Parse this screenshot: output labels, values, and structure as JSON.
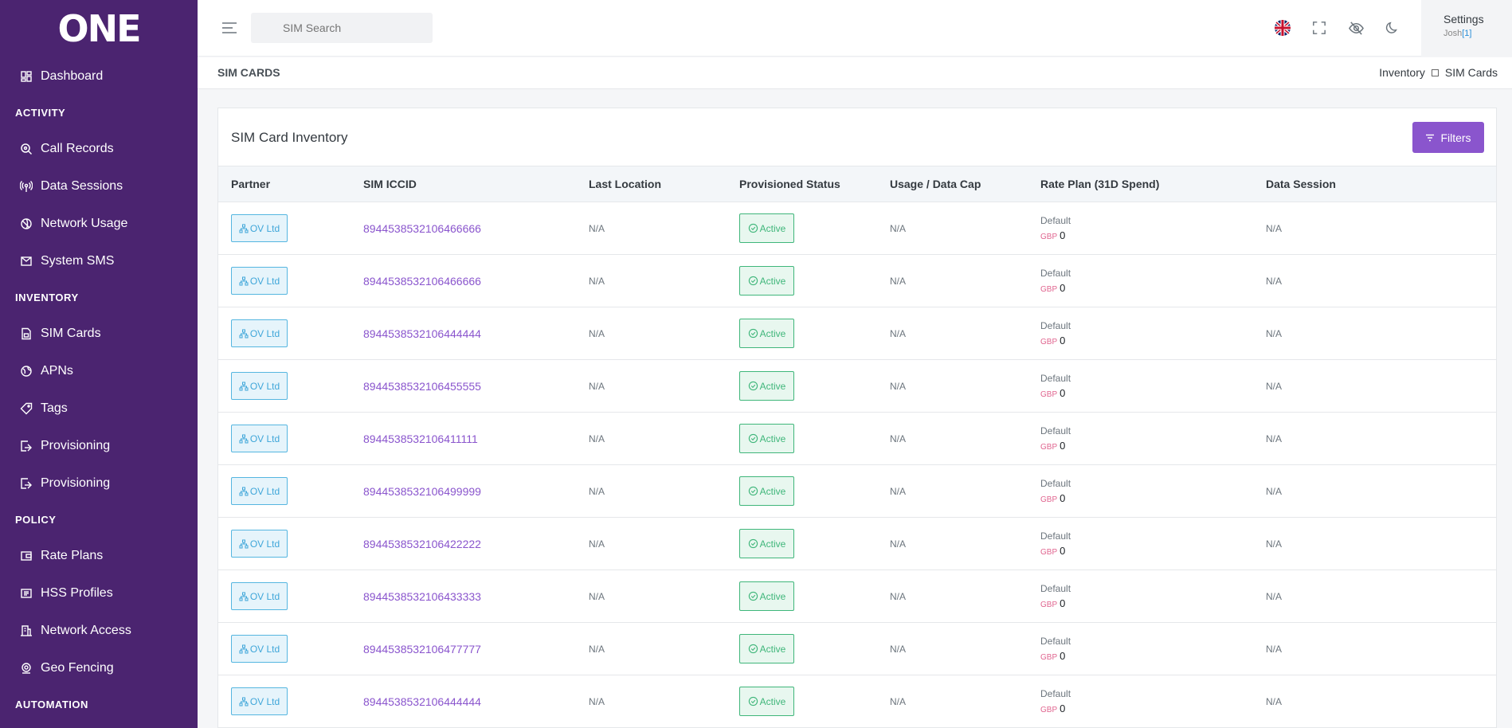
{
  "app": {
    "logo_text": "ONE"
  },
  "sidebar": {
    "dashboard": "Dashboard",
    "sections": {
      "activity": "ACTIVITY",
      "inventory": "INVENTORY",
      "policy": "POLICY",
      "automation": "AUTOMATION"
    },
    "activity_items": [
      {
        "label": "Call Records",
        "icon": "search-icon"
      },
      {
        "label": "Data Sessions",
        "icon": "broadcast-icon"
      },
      {
        "label": "Network Usage",
        "icon": "network-icon"
      },
      {
        "label": "System SMS",
        "icon": "mail-icon"
      }
    ],
    "inventory_items": [
      {
        "label": "SIM Cards",
        "icon": "sim-icon"
      },
      {
        "label": "APNs",
        "icon": "globe-icon"
      },
      {
        "label": "Tags",
        "icon": "tag-icon"
      },
      {
        "label": "Provisioning",
        "icon": "provision-icon"
      },
      {
        "label": "Provisioning",
        "icon": "provision-icon"
      }
    ],
    "policy_items": [
      {
        "label": "Rate Plans",
        "icon": "wallet-icon"
      },
      {
        "label": "HSS Profiles",
        "icon": "list-icon"
      },
      {
        "label": "Network Access",
        "icon": "building-icon"
      },
      {
        "label": "Geo Fencing",
        "icon": "location-icon"
      }
    ]
  },
  "topbar": {
    "search_placeholder": "SIM Search",
    "settings_label": "Settings",
    "user_name": "Josh",
    "user_badge": "[1]"
  },
  "page": {
    "title": "SIM CARDS",
    "breadcrumb": [
      "Inventory",
      "SIM Cards"
    ]
  },
  "card": {
    "title": "SIM Card Inventory",
    "filters_label": "Filters"
  },
  "table": {
    "headers": [
      "Partner",
      "SIM ICCID",
      "Last Location",
      "Provisioned Status",
      "Usage / Data Cap",
      "Rate Plan (31D Spend)",
      "Data Session"
    ],
    "rows": [
      {
        "partner": "OV Ltd",
        "iccid": "8944538532106466666",
        "location": "N/A",
        "status": "Active",
        "usage": "N/A",
        "rate_plan": "Default",
        "currency": "GBP",
        "spend": "0",
        "session": "N/A"
      },
      {
        "partner": "OV Ltd",
        "iccid": "8944538532106466666",
        "location": "N/A",
        "status": "Active",
        "usage": "N/A",
        "rate_plan": "Default",
        "currency": "GBP",
        "spend": "0",
        "session": "N/A"
      },
      {
        "partner": "OV Ltd",
        "iccid": "8944538532106444444",
        "location": "N/A",
        "status": "Active",
        "usage": "N/A",
        "rate_plan": "Default",
        "currency": "GBP",
        "spend": "0",
        "session": "N/A"
      },
      {
        "partner": "OV Ltd",
        "iccid": "8944538532106455555",
        "location": "N/A",
        "status": "Active",
        "usage": "N/A",
        "rate_plan": "Default",
        "currency": "GBP",
        "spend": "0",
        "session": "N/A"
      },
      {
        "partner": "OV Ltd",
        "iccid": "8944538532106411111",
        "location": "N/A",
        "status": "Active",
        "usage": "N/A",
        "rate_plan": "Default",
        "currency": "GBP",
        "spend": "0",
        "session": "N/A"
      },
      {
        "partner": "OV Ltd",
        "iccid": "8944538532106499999",
        "location": "N/A",
        "status": "Active",
        "usage": "N/A",
        "rate_plan": "Default",
        "currency": "GBP",
        "spend": "0",
        "session": "N/A"
      },
      {
        "partner": "OV Ltd",
        "iccid": "8944538532106422222",
        "location": "N/A",
        "status": "Active",
        "usage": "N/A",
        "rate_plan": "Default",
        "currency": "GBP",
        "spend": "0",
        "session": "N/A"
      },
      {
        "partner": "OV Ltd",
        "iccid": "8944538532106433333",
        "location": "N/A",
        "status": "Active",
        "usage": "N/A",
        "rate_plan": "Default",
        "currency": "GBP",
        "spend": "0",
        "session": "N/A"
      },
      {
        "partner": "OV Ltd",
        "iccid": "8944538532106477777",
        "location": "N/A",
        "status": "Active",
        "usage": "N/A",
        "rate_plan": "Default",
        "currency": "GBP",
        "spend": "0",
        "session": "N/A"
      },
      {
        "partner": "OV Ltd",
        "iccid": "8944538532106444444",
        "location": "N/A",
        "status": "Active",
        "usage": "N/A",
        "rate_plan": "Default",
        "currency": "GBP",
        "spend": "0",
        "session": "N/A"
      }
    ]
  },
  "colors": {
    "sidebar_bg": "#4b2470",
    "accent": "#8a55cd",
    "partner_blue": "#3fa6d9",
    "active_green": "#3fb67a",
    "currency_pink": "#e0658f"
  }
}
